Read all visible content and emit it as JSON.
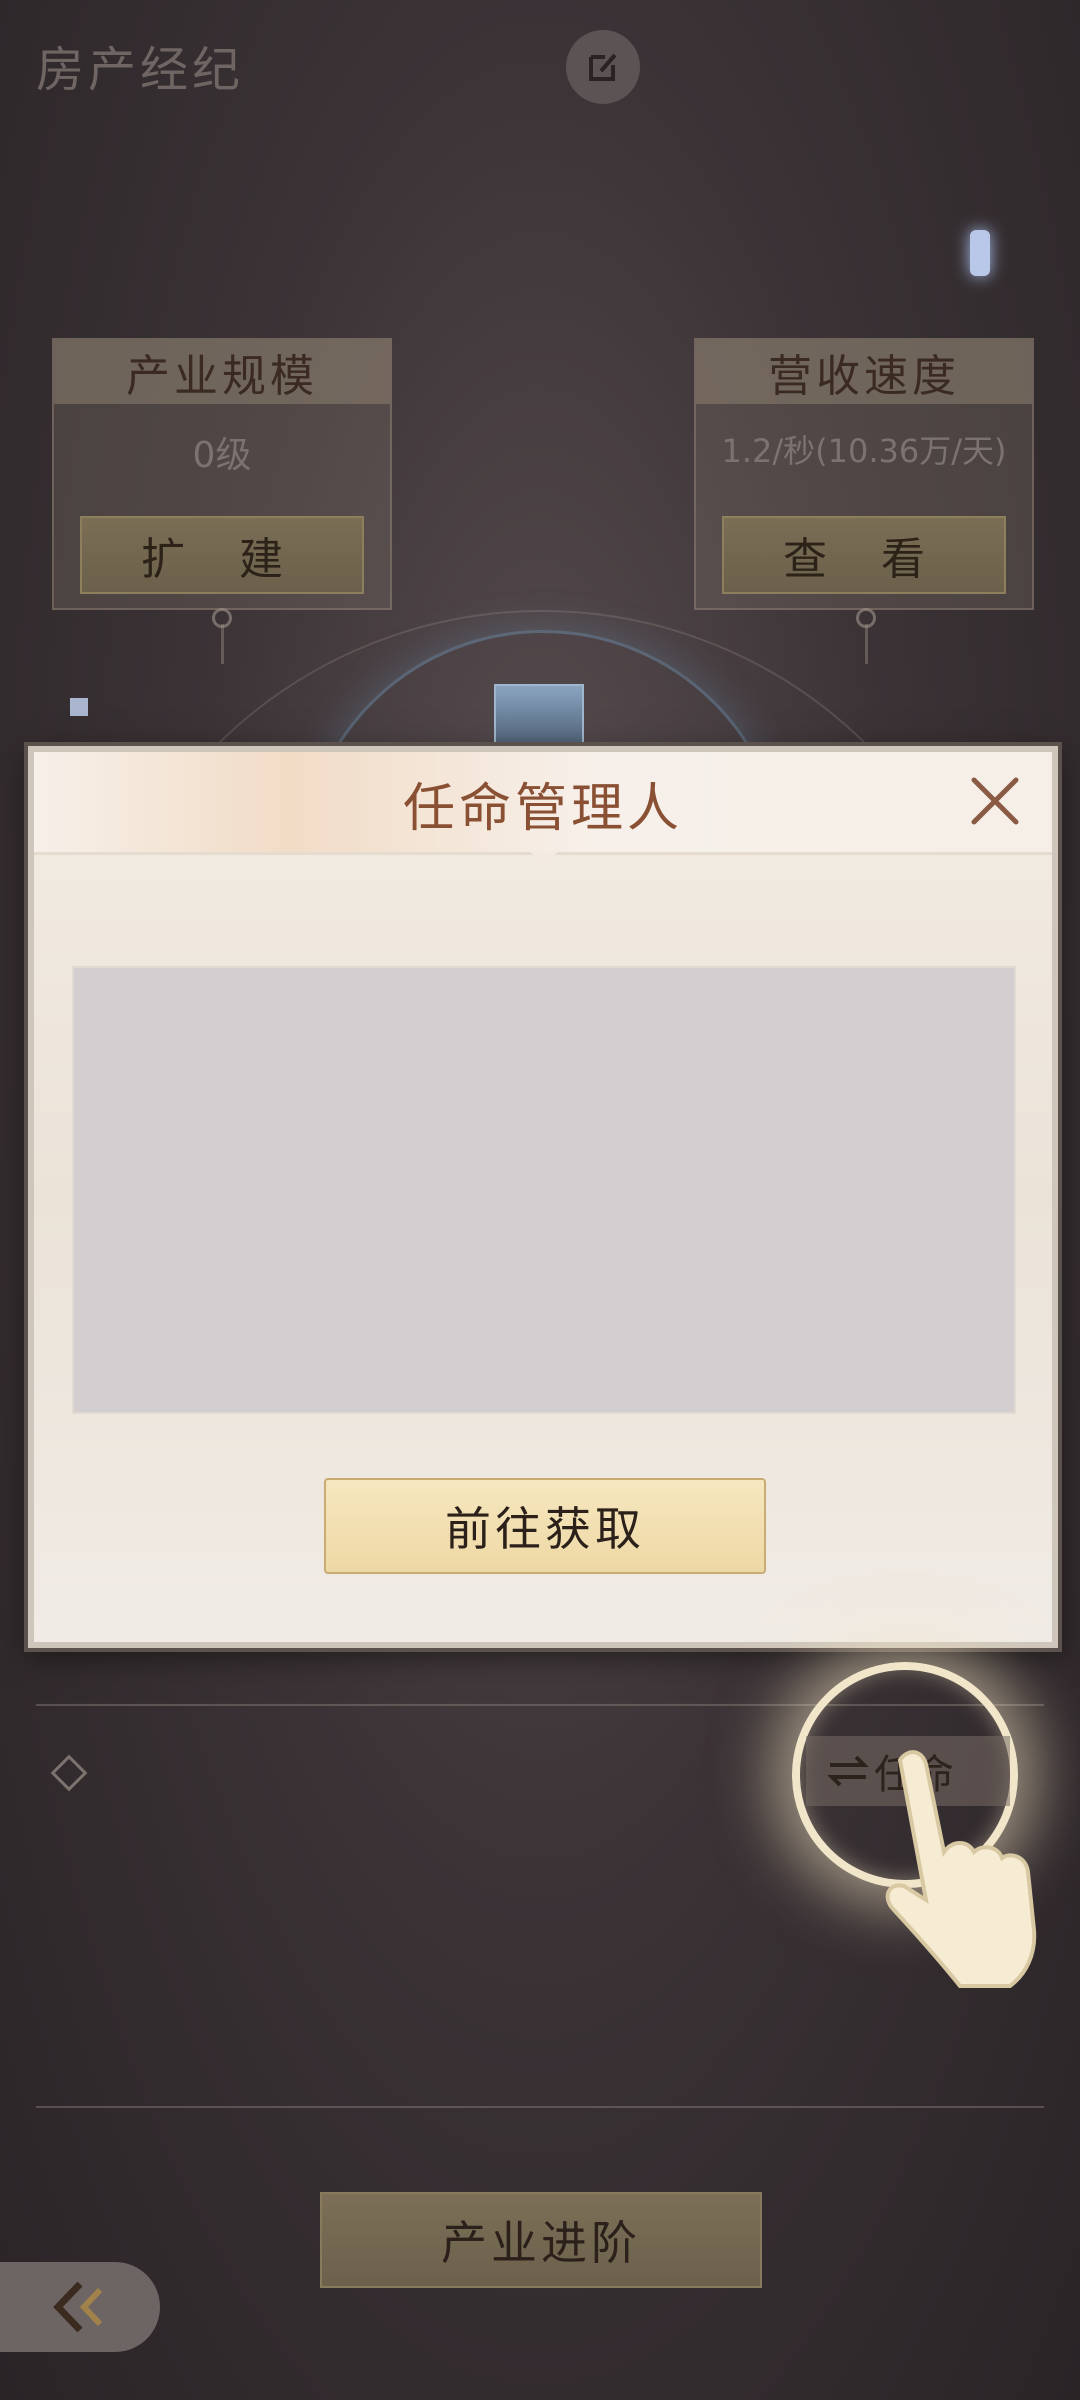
{
  "header": {
    "title": "房产经纪",
    "edit_icon": "edit-icon"
  },
  "cards": [
    {
      "heading": "产业规模",
      "value": "0级",
      "button": "扩 建"
    },
    {
      "heading": "营收速度",
      "value": "1.2/秒(10.36万/天)",
      "button": "查 看"
    }
  ],
  "modal": {
    "title": "任命管理人",
    "close_icon": "close-icon",
    "primary_button": "前往获取"
  },
  "manager_row": {
    "appoint_button": "任命",
    "appoint_icon": "swap-arrows-icon",
    "diamond_icon": "diamond-icon"
  },
  "footer": {
    "advance_button": "产业进阶",
    "back_icon": "double-chevron-left-icon"
  },
  "colors": {
    "accent_text": "#8a5034",
    "modal_bg": "#efe8df",
    "button_gold": "#f3e2b5",
    "page_bg": "#3b3336"
  }
}
